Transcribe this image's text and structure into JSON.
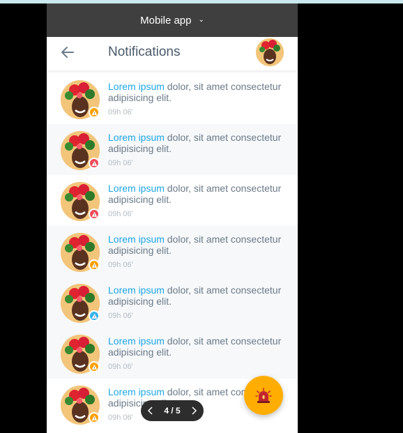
{
  "app_bar": {
    "title": "Mobile app"
  },
  "header": {
    "title": "Notifications"
  },
  "notifications": [
    {
      "highlight": "Lorem ipsum",
      "text": " dolor, sit amet consectetur adipisicing elit.",
      "time": "09h 06'",
      "badge_color": "#ffa000"
    },
    {
      "highlight": "Lorem ipsum",
      "text": " dolor, sit amet consectetur adipisicing elit.",
      "time": "09h 06'",
      "badge_color": "#ef4b5a"
    },
    {
      "highlight": "Lorem ipsum",
      "text": " dolor, sit amet consectetur adipisicing elit.",
      "time": "09h 06'",
      "badge_color": "#ef4b5a"
    },
    {
      "highlight": "Lorem ipsum",
      "text": " dolor, sit amet consectetur adipisicing elit.",
      "time": "09h 06'",
      "badge_color": "#ffa000"
    },
    {
      "highlight": "Lorem ipsum",
      "text": " dolor, sit amet consectetur adipisicing elit.",
      "time": "09h 06'",
      "badge_color": "#35b3ec"
    },
    {
      "highlight": "Lorem ipsum",
      "text": " dolor, sit amet consectetur adipisicing elit.",
      "time": "09h 06'",
      "badge_color": "#ffa000"
    },
    {
      "highlight": "Lorem ipsum",
      "text": " dolor, sit amet consectetur adipisicing elit.",
      "time": "09h 06'",
      "badge_color": "#ffa000"
    }
  ],
  "pager": {
    "label": "4 / 5"
  },
  "fab": {
    "icon": "alarm-siren-icon",
    "color": "#ffad00"
  },
  "colors": {
    "accent": "#1ea6e5",
    "app_bar": "#3f3f3f"
  }
}
